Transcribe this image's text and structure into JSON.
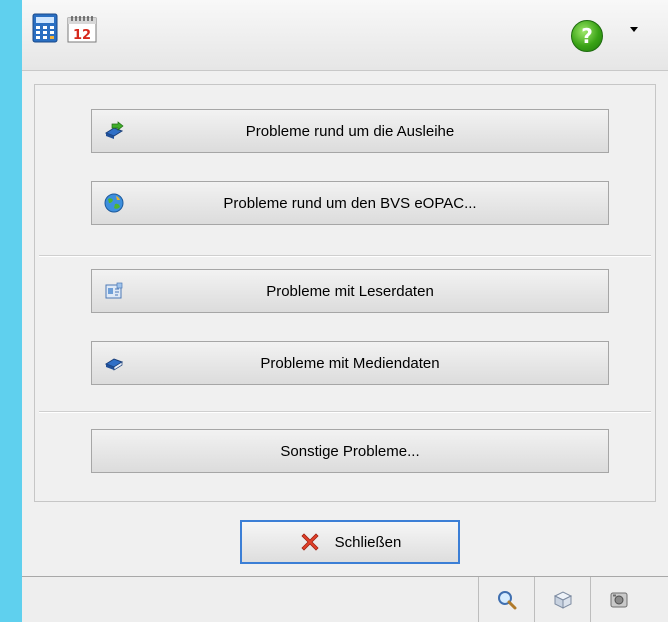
{
  "toolbar": {
    "calculator_icon": "calculator-icon",
    "calendar_icon": "calendar-icon",
    "calendar_day": "12",
    "help_icon": "help-icon",
    "help_symbol": "?",
    "dropdown_icon": "chevron-down-icon"
  },
  "buttons": {
    "loans": "Probleme rund um die Ausleihe",
    "eopac": "Probleme rund um den BVS eOPAC...",
    "reader": "Probleme mit Leserdaten",
    "media": "Probleme mit Mediendaten",
    "other": "Sonstige Probleme..."
  },
  "close": {
    "label": "Schließen"
  },
  "statusbar": {
    "icons": [
      "magnifier-icon",
      "box-icon",
      "camera-icon"
    ]
  }
}
